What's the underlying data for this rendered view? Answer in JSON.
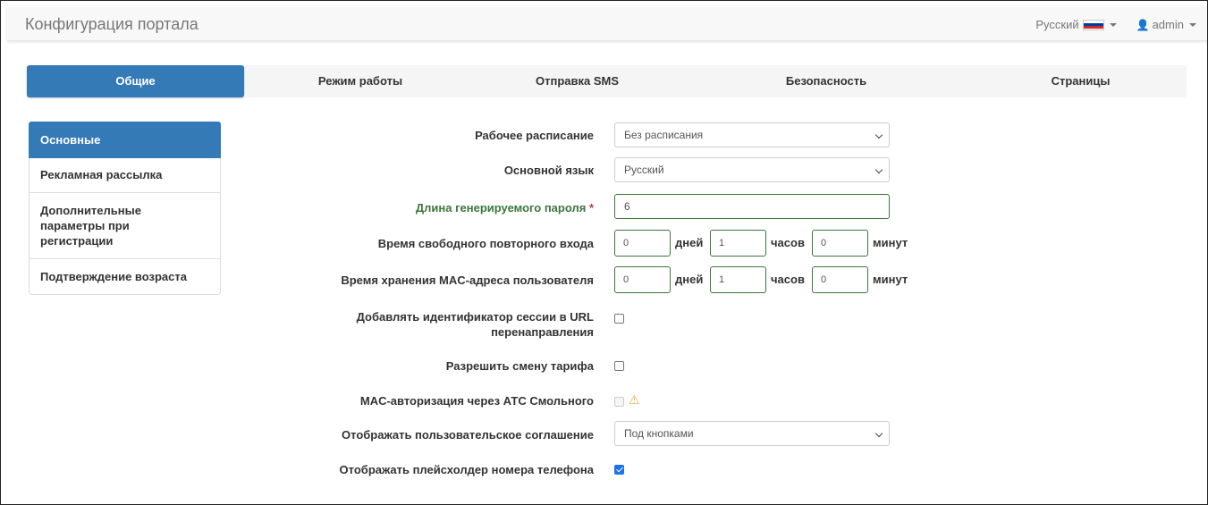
{
  "header": {
    "title": "Конфигурация портала",
    "language": "Русский",
    "user": "admin",
    "flag_colors": [
      "#ffffff",
      "#0039a6",
      "#d52b1e"
    ]
  },
  "tabs": [
    {
      "label": "Общие",
      "active": true
    },
    {
      "label": "Режим работы"
    },
    {
      "label": "Отправка SMS"
    },
    {
      "label": "Безопасность"
    },
    {
      "label": "Страницы"
    }
  ],
  "sidebar": {
    "items": [
      {
        "label": "Основные",
        "active": true
      },
      {
        "label": "Рекламная рассылка"
      },
      {
        "label": "Дополнительные параметры при регистрации"
      },
      {
        "label": "Подтверждение возраста"
      }
    ]
  },
  "form": {
    "schedule": {
      "label": "Рабочее расписание",
      "value": "Без расписания"
    },
    "language": {
      "label": "Основной язык",
      "value": "Русский"
    },
    "password_length": {
      "label": "Длина генерируемого пароля",
      "required_mark": "*",
      "value": "6"
    },
    "relogin": {
      "label": "Время свободного повторного входа",
      "days": "0",
      "hours": "1",
      "minutes": "0"
    },
    "mac_store": {
      "label": "Время хранения MAC-адреса пользователя",
      "days": "0",
      "hours": "1",
      "minutes": "0"
    },
    "units": {
      "days": "дней",
      "hours": "часов",
      "minutes": "минут"
    },
    "session_id_url": {
      "label_line1": "Добавлять идентификатор сессии в URL",
      "label_line2": "перенаправления",
      "checked": false
    },
    "tariff_change": {
      "label": "Разрешить смену тарифа",
      "checked": false
    },
    "mac_auth": {
      "label": "MAC-авторизация через АТС Смольного",
      "checked": false,
      "disabled": true,
      "icon": "warning-icon"
    },
    "agreement": {
      "label": "Отображать пользовательское соглашение",
      "value": "Под кнопками"
    },
    "phone_placeholder": {
      "label": "Отображать плейсхолдер номера телефона",
      "checked": true
    }
  },
  "colors": {
    "primary": "#337ab7",
    "success": "#3c763d",
    "warning": "#f0ad4e"
  }
}
